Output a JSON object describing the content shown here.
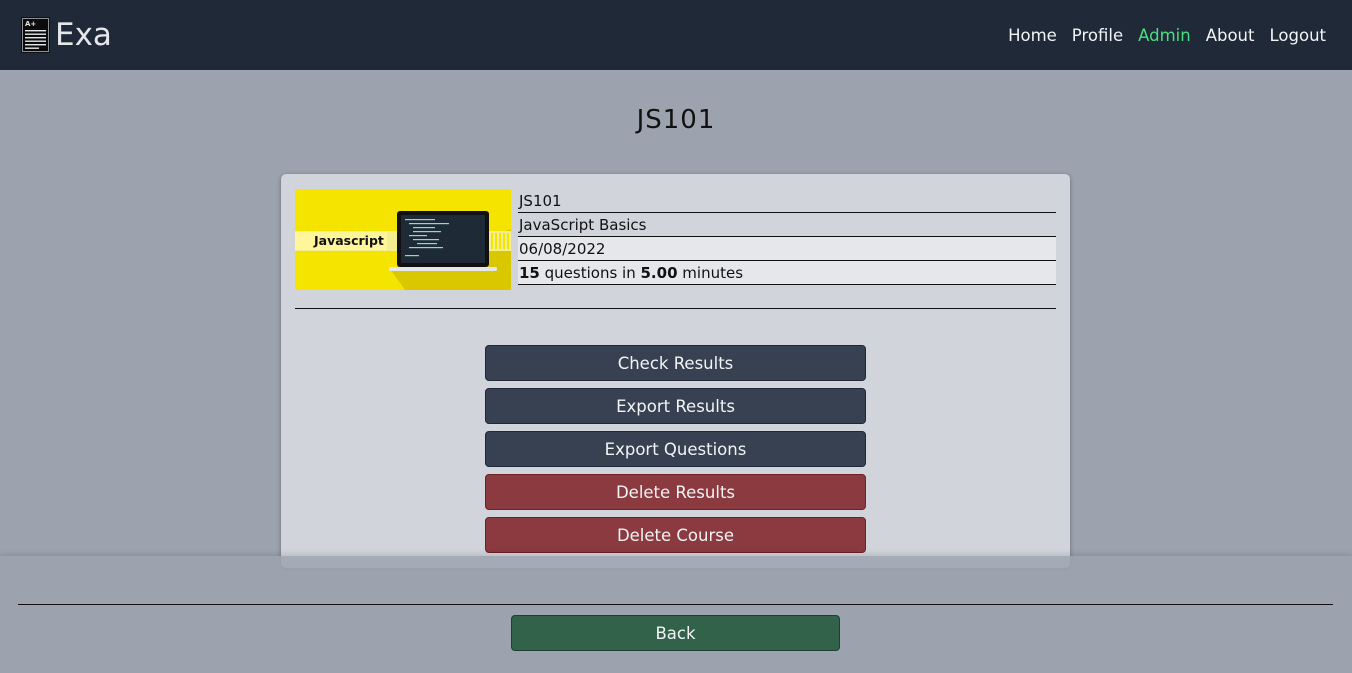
{
  "navbar": {
    "brand": "Exa",
    "logo_icon": "exam-paper-icon",
    "links": [
      {
        "label": "Home",
        "active": false
      },
      {
        "label": "Profile",
        "active": false
      },
      {
        "label": "Admin",
        "active": true
      },
      {
        "label": "About",
        "active": false
      },
      {
        "label": "Logout",
        "active": false
      }
    ],
    "active_color": "#4ade80",
    "background": "#1f2937"
  },
  "page": {
    "title": "JS101"
  },
  "course": {
    "thumbnail_label": "Javascript",
    "code": "JS101",
    "name": "JavaScript Basics",
    "date": "06/08/2022",
    "question_count": "15",
    "questions_in": "questions in",
    "duration": "5.00",
    "duration_unit": "minutes"
  },
  "actions": {
    "check_results": "Check Results",
    "export_results": "Export Results",
    "export_questions": "Export Questions",
    "delete_results": "Delete Results",
    "delete_course": "Delete Course"
  },
  "footer": {
    "back": "Back"
  },
  "colors": {
    "page_bg": "#9ca3af",
    "card_bg": "#d1d5db",
    "dark_button": "#374151",
    "danger_button": "#8b3a3f",
    "back_button": "#32624a"
  }
}
